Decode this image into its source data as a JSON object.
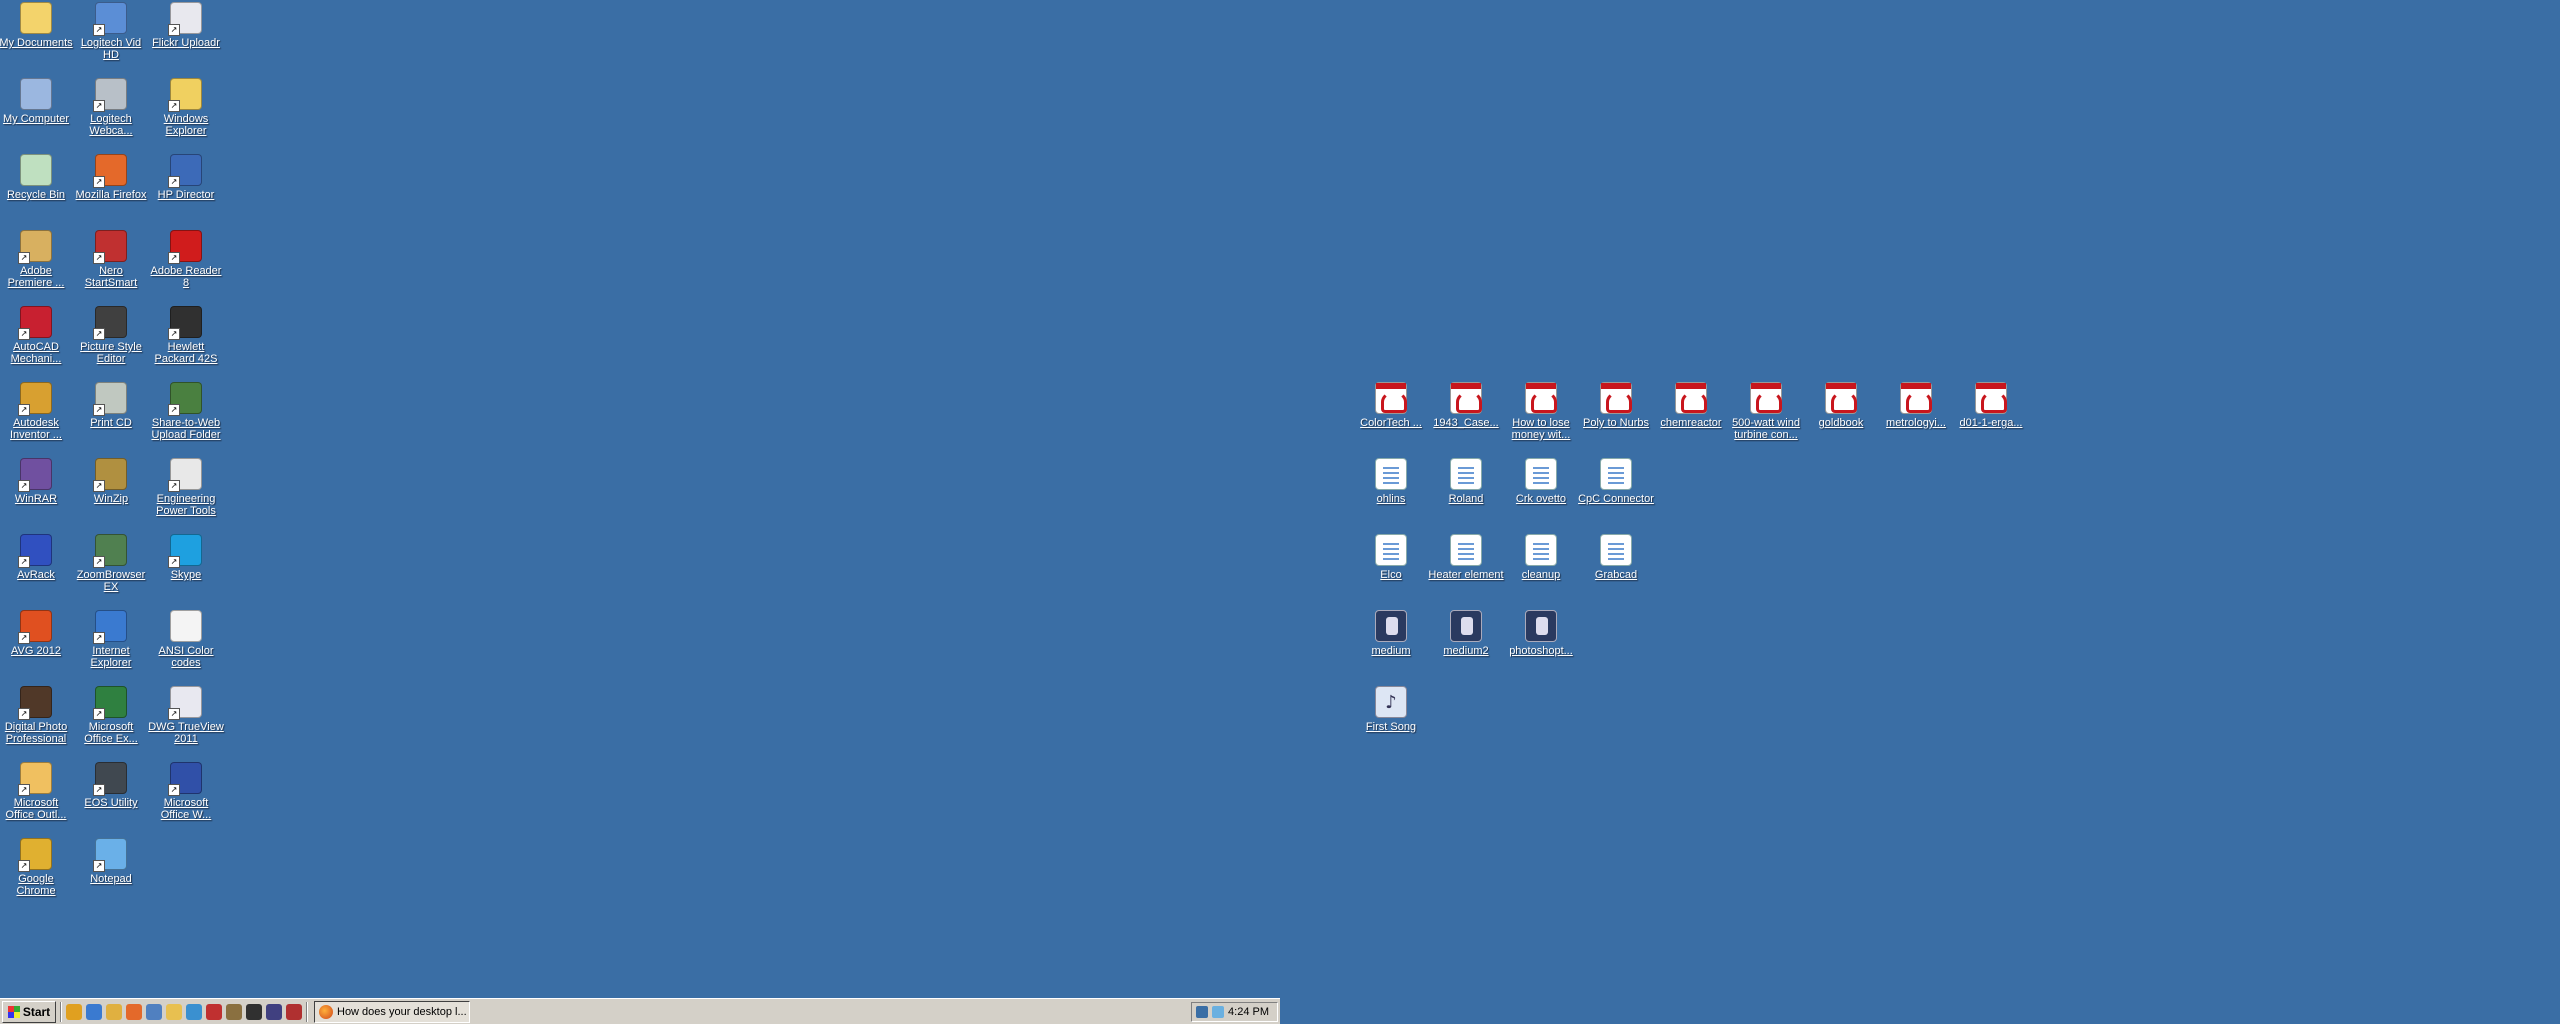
{
  "desktop": {
    "background": "#3a6ea5",
    "left_icons": [
      {
        "label": "My Documents",
        "icon": "folder-documents-icon",
        "color": "#f3d36b"
      },
      {
        "label": "Logitech Vid HD",
        "icon": "logitech-vid-icon",
        "color": "#5b8ed6"
      },
      {
        "label": "Flickr Uploadr",
        "icon": "flickr-icon",
        "color": "#e8e8ee"
      },
      {
        "label": "My Computer",
        "icon": "computer-icon",
        "color": "#9bb7e0"
      },
      {
        "label": "Logitech Webca...",
        "icon": "webcam-icon",
        "color": "#b8c0c8"
      },
      {
        "label": "Windows Explorer",
        "icon": "folder-explorer-icon",
        "color": "#f0d060"
      },
      {
        "label": "Recycle Bin",
        "icon": "recycle-bin-icon",
        "color": "#bfe0c0"
      },
      {
        "label": "Mozilla Firefox",
        "icon": "firefox-icon",
        "color": "#e4692a"
      },
      {
        "label": "HP Director",
        "icon": "hp-director-icon",
        "color": "#3c6ab8"
      },
      {
        "label": "Adobe Premiere ...",
        "icon": "premiere-icon",
        "color": "#d8b060"
      },
      {
        "label": "Nero StartSmart",
        "icon": "nero-icon",
        "color": "#c03030"
      },
      {
        "label": "Adobe Reader 8",
        "icon": "adobe-reader-icon",
        "color": "#d01c1c"
      },
      {
        "label": "AutoCAD Mechani...",
        "icon": "autocad-icon",
        "color": "#c82030"
      },
      {
        "label": "Picture Style Editor",
        "icon": "picture-style-icon",
        "color": "#404040"
      },
      {
        "label": "Hewlett Packard 42S",
        "icon": "calculator-icon",
        "color": "#303030"
      },
      {
        "label": "Autodesk Inventor ...",
        "icon": "inventor-icon",
        "color": "#d8a030"
      },
      {
        "label": "Print CD",
        "icon": "print-cd-icon",
        "color": "#c0c8c0"
      },
      {
        "label": "Share-to-Web Upload Folder",
        "icon": "share-web-icon",
        "color": "#4a8040"
      },
      {
        "label": "WinRAR",
        "icon": "winrar-icon",
        "color": "#7050a0"
      },
      {
        "label": "WinZip",
        "icon": "winzip-icon",
        "color": "#b09040"
      },
      {
        "label": "Engineering Power Tools",
        "icon": "compass-icon",
        "color": "#e8e8e8"
      },
      {
        "label": "AvRack",
        "icon": "avrack-icon",
        "color": "#3050c0"
      },
      {
        "label": "ZoomBrowser EX",
        "icon": "zoombrowser-icon",
        "color": "#508050"
      },
      {
        "label": "Skype",
        "icon": "skype-icon",
        "color": "#1ea0e0"
      },
      {
        "label": "AVG 2012",
        "icon": "avg-icon",
        "color": "#e05020"
      },
      {
        "label": "Internet Explorer",
        "icon": "ie-icon",
        "color": "#3a7ad0"
      },
      {
        "label": "ANSI Color codes",
        "icon": "document-icon",
        "color": "#f4f4f4"
      },
      {
        "label": "Digital Photo Professional",
        "icon": "dpp-icon",
        "color": "#503828"
      },
      {
        "label": "Microsoft Office Ex...",
        "icon": "excel-icon",
        "color": "#2f8040"
      },
      {
        "label": "DWG TrueView 2011",
        "icon": "dwg-icon",
        "color": "#e8e8f0"
      },
      {
        "label": "Microsoft Office Outl...",
        "icon": "outlook-icon",
        "color": "#f0c060"
      },
      {
        "label": "EOS Utility",
        "icon": "eos-icon",
        "color": "#404850"
      },
      {
        "label": "Microsoft Office W...",
        "icon": "word-icon",
        "color": "#3050a8"
      },
      {
        "label": "Google Chrome",
        "icon": "chrome-icon",
        "color": "#e0b030"
      },
      {
        "label": "Notepad",
        "icon": "notepad-icon",
        "color": "#6ab0e8"
      }
    ],
    "right_icons": [
      {
        "label": "ColorTech ...",
        "type": "pdf"
      },
      {
        "label": "1943_Case...",
        "type": "pdf"
      },
      {
        "label": "How to lose money wit...",
        "type": "pdf"
      },
      {
        "label": "Poly to Nurbs",
        "type": "pdf"
      },
      {
        "label": "chemreactor",
        "type": "pdf"
      },
      {
        "label": "500-watt wind turbine con...",
        "type": "pdf"
      },
      {
        "label": "goldbook",
        "type": "pdf"
      },
      {
        "label": "metrologyi...",
        "type": "pdf"
      },
      {
        "label": "d01-1-erga...",
        "type": "pdf"
      },
      {
        "label": "ohlins",
        "type": "doc"
      },
      {
        "label": "Roland",
        "type": "doc"
      },
      {
        "label": "Crk ovetto",
        "type": "doc"
      },
      {
        "label": "CpC Connector",
        "type": "doc"
      },
      {
        "label": "Elco",
        "type": "doc"
      },
      {
        "label": "Heater element",
        "type": "doc"
      },
      {
        "label": "cleanup",
        "type": "doc"
      },
      {
        "label": "Grabcad",
        "type": "doc"
      },
      {
        "label": "medium",
        "type": "img"
      },
      {
        "label": "medium2",
        "type": "img"
      },
      {
        "label": "photoshopt...",
        "type": "img"
      },
      {
        "label": "First Song",
        "type": "song"
      }
    ]
  },
  "taskbar": {
    "start_label": "Start",
    "quick_launch": [
      {
        "icon": "chrome-icon",
        "color": "#e0a020"
      },
      {
        "icon": "ie-icon",
        "color": "#3a7ad0"
      },
      {
        "icon": "outlook-icon",
        "color": "#e0b040"
      },
      {
        "icon": "firefox-icon",
        "color": "#e4692a"
      },
      {
        "icon": "explorer-icon",
        "color": "#5080c0"
      },
      {
        "icon": "folder-icon",
        "color": "#e8c050"
      },
      {
        "icon": "help-icon",
        "color": "#3a90d0"
      },
      {
        "icon": "nero-icon",
        "color": "#c03030"
      },
      {
        "icon": "archive-icon",
        "color": "#8a7040"
      },
      {
        "icon": "terminal-icon",
        "color": "#303030"
      },
      {
        "icon": "clock-icon",
        "color": "#404080"
      },
      {
        "icon": "toolbox-icon",
        "color": "#b03030"
      }
    ],
    "task_button_label": "How does your desktop l...",
    "clock": "4:24 PM"
  }
}
